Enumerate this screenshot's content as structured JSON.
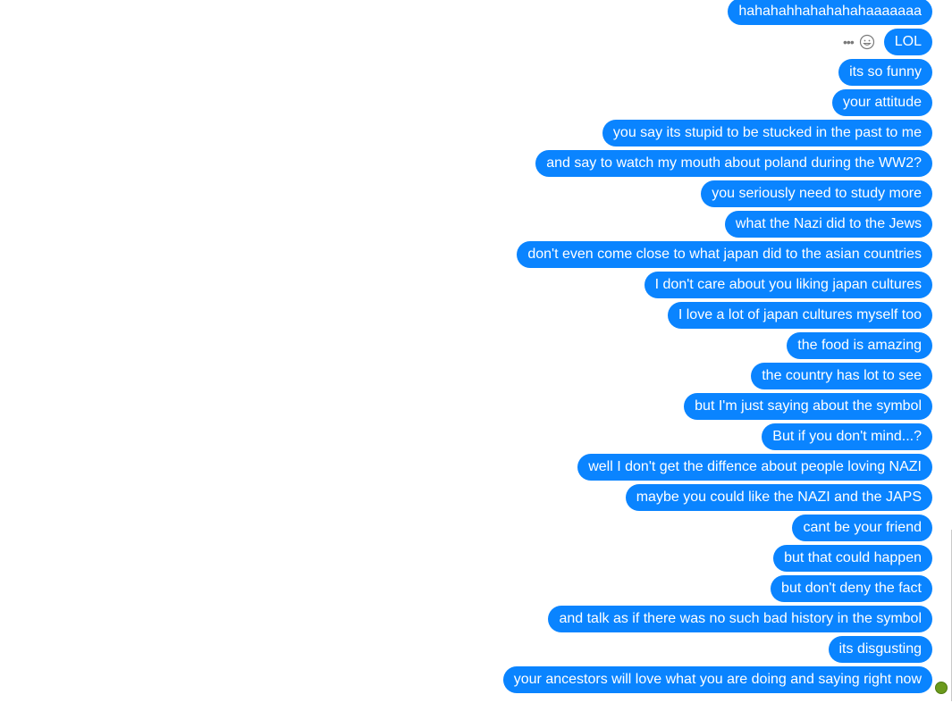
{
  "conversation": {
    "messages": [
      {
        "text": "hahahahhahahahahaaaaaaa"
      },
      {
        "text": "LOL"
      },
      {
        "text": "its so funny"
      },
      {
        "text": "your attitude"
      },
      {
        "text": "you say its stupid to be stucked in the past to me"
      },
      {
        "text": "and say to watch my mouth about poland during the WW2?"
      },
      {
        "text": "you seriously need to study more"
      },
      {
        "text": "what the Nazi did to the Jews"
      },
      {
        "text": "don't even come close to what japan did to the asian countries"
      },
      {
        "text": "I don't care about you liking japan cultures"
      },
      {
        "text": "I love a lot of japan cultures myself too"
      },
      {
        "text": "the food is amazing"
      },
      {
        "text": "the country has lot to see"
      },
      {
        "text": "but I'm just saying about the symbol"
      },
      {
        "text": "But if you don't mind...?"
      },
      {
        "text": "well I don't get the diffence about people loving NAZI"
      },
      {
        "text": "maybe you could like the NAZI and the JAPS"
      },
      {
        "text": "cant be your friend"
      },
      {
        "text": "but that could happen"
      },
      {
        "text": "but don't deny the fact"
      },
      {
        "text": "and talk as if there was no such bad history in the symbol"
      },
      {
        "text": "its disgusting"
      },
      {
        "text": "your ancestors will love what you are doing and saying right now"
      }
    ],
    "hover_actions": {
      "more_icon": "more-options-icon",
      "react_icon": "emoji-react-icon"
    },
    "colors": {
      "bubble": "#0a84ff",
      "bubble_text": "#ffffff",
      "seen_avatar": "#6b9a1c"
    }
  }
}
